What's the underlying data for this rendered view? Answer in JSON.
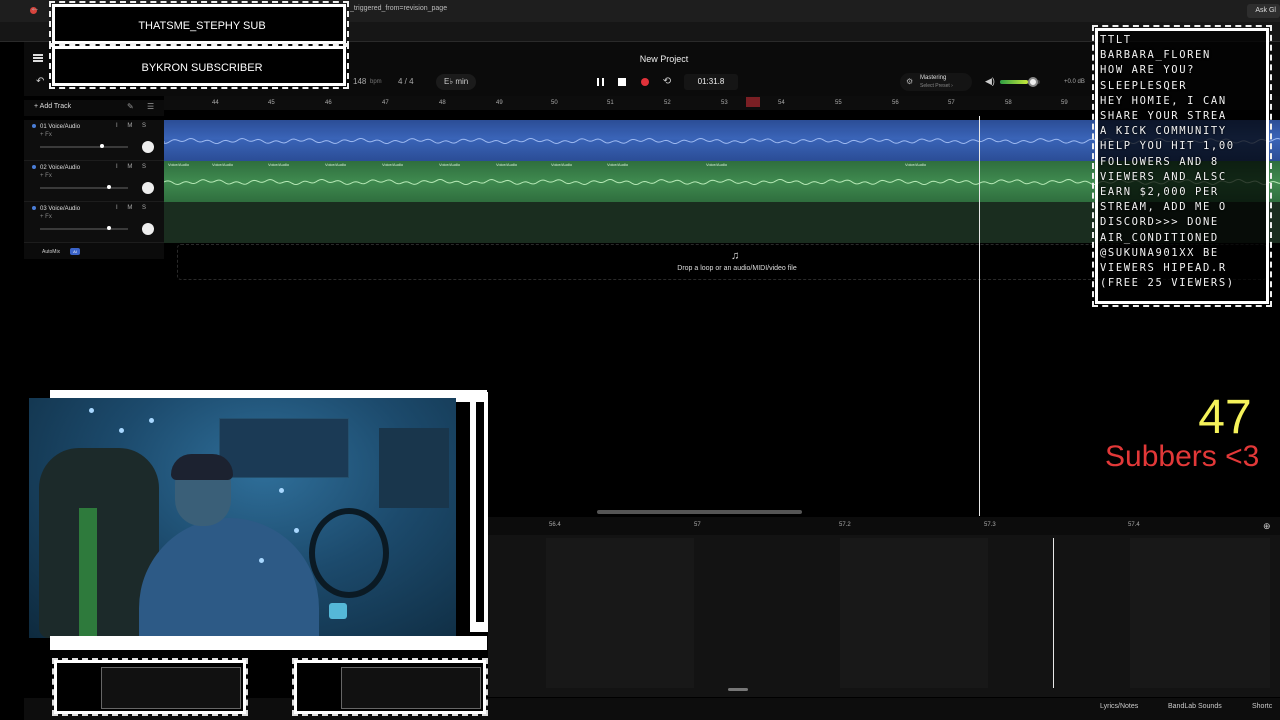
{
  "browser": {
    "ask_button": "Ask Gl",
    "url_fragment": "_triggered_from=revision_page"
  },
  "project": {
    "title": "New Project"
  },
  "toolbar": {
    "bpm": "148",
    "bpm_unit": "bpm",
    "time_signature": "4 / 4",
    "key": "E♭ min",
    "time": "01:31.8",
    "mastering_label": "Mastering",
    "mastering_sub": "Select Preset ›",
    "volume_level": 0.7,
    "db_label": "+0.0 dB"
  },
  "tracks_header": {
    "add_track": "+ Add Track"
  },
  "ruler": {
    "marks": [
      "44",
      "45",
      "46",
      "47",
      "48",
      "49",
      "50",
      "51",
      "52",
      "53",
      "54",
      "55",
      "56",
      "57",
      "58",
      "59"
    ]
  },
  "tracks": [
    {
      "name": "01 Voice/Audio",
      "fx": "+ Fx",
      "ms": "I M S",
      "fader": 0.72
    },
    {
      "name": "02 Voice/Audio",
      "fx": "+ Fx",
      "ms": "I M S",
      "fader": 0.8
    },
    {
      "name": "03 Voice/Audio",
      "fx": "+ Fx",
      "ms": "I M S",
      "fader": 0.8
    }
  ],
  "clip_label": "Voice/Audio",
  "automix": {
    "label": "AutoMix",
    "badge": "AI"
  },
  "drop_zone": {
    "text": "Drop a loop or an audio/MIDI/video file"
  },
  "bottom_ruler": {
    "marks": [
      "56.4",
      "57",
      "57.2",
      "57.3",
      "57.4"
    ]
  },
  "footer": {
    "lyrics": "Lyrics/Notes",
    "sounds": "BandLab Sounds",
    "shortcuts": "Shortc"
  },
  "overlay": {
    "sub_line_1": "THATSME_STEPHY SUB",
    "sub_line_2": "BYKRON SUBSCRIBER",
    "chat_lines": [
      "TTLT",
      "BARBARA_FLOREN",
      "HOW ARE YOU?",
      "SLEEPLESQER",
      "HEY HOMIE, I CAN",
      "SHARE YOUR STREA",
      "A KICK COMMUNITY",
      "HELP YOU HIT 1,00",
      "FOLLOWERS AND 8",
      "VIEWERS AND ALSC",
      "EARN $2,000 PER",
      "STREAM, ADD ME O",
      "DISCORD>>> DONE",
      "AIR_CONDITIONED",
      "@SUKUNA901XX BE",
      "VIEWERS HIPEAD.R",
      "(FREE 25 VIEWERS)"
    ],
    "sub_count": "47",
    "sub_count_label": "Subbers <3"
  },
  "colors": {
    "track1": "#3a64b8",
    "track2": "#3f8a4f",
    "record": "#e0323a",
    "count": "#f5f25a",
    "count_label": "#e23838"
  }
}
